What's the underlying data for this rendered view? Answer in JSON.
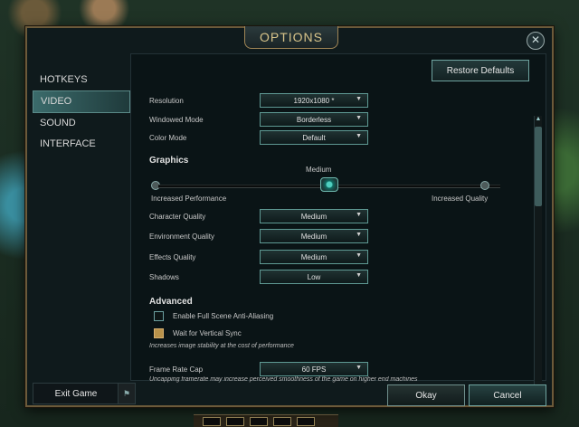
{
  "window": {
    "title": "OPTIONS"
  },
  "sidebar": {
    "items": [
      {
        "label": "HOTKEYS"
      },
      {
        "label": "VIDEO"
      },
      {
        "label": "SOUND"
      },
      {
        "label": "INTERFACE"
      }
    ]
  },
  "toolbar": {
    "restore_label": "Restore Defaults"
  },
  "video": {
    "resolution": {
      "label": "Resolution",
      "value": "1920x1080 *"
    },
    "windowed_mode": {
      "label": "Windowed Mode",
      "value": "Borderless"
    },
    "color_mode": {
      "label": "Color Mode",
      "value": "Default"
    },
    "graphics": {
      "title": "Graphics",
      "preset": "Medium",
      "left_label": "Increased Performance",
      "right_label": "Increased Quality",
      "level_fraction": 0.5
    },
    "character_quality": {
      "label": "Character Quality",
      "value": "Medium"
    },
    "environment_quality": {
      "label": "Environment Quality",
      "value": "Medium"
    },
    "effects_quality": {
      "label": "Effects Quality",
      "value": "Medium"
    },
    "shadows": {
      "label": "Shadows",
      "value": "Low"
    },
    "advanced": {
      "title": "Advanced",
      "anti_aliasing": {
        "label": "Enable Full Scene Anti-Aliasing",
        "checked": false
      },
      "vsync": {
        "label": "Wait for Vertical Sync",
        "checked": true
      },
      "vsync_note": "Increases image stability at the cost of performance"
    },
    "frame_rate_cap": {
      "label": "Frame Rate Cap",
      "value": "60 FPS"
    },
    "frame_rate_note": "Uncapping framerate may increase perceived smoothness of the game on higher end machines"
  },
  "footer": {
    "exit_label": "Exit Game",
    "okay_label": "Okay",
    "cancel_label": "Cancel"
  },
  "icons": {
    "close": "close-icon",
    "flag": "flag-icon",
    "caret": "chevron-down-icon"
  },
  "colors": {
    "accent": "#6fa4a0",
    "gold": "#d8c48a",
    "panel_bg": "#0a1416"
  }
}
